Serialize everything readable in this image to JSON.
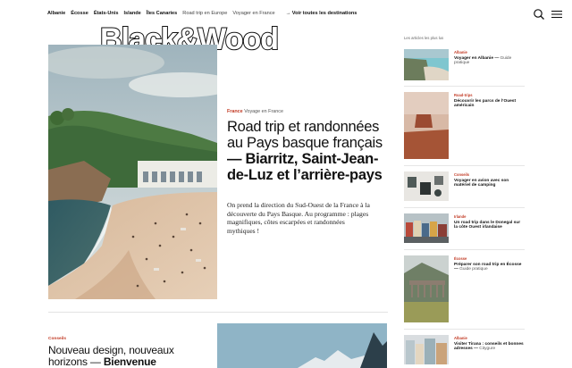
{
  "nav": {
    "items": [
      "Albanie",
      "Écosse",
      "États-Unis",
      "Islande",
      "Îles Canaries",
      "Road trip en Europe",
      "Voyager en France"
    ],
    "all": "→ Voir toutes les destinations"
  },
  "logo": "Black&Wood",
  "hero": {
    "category": "France",
    "subcategory": "Voyage en France",
    "title_regular": "Road trip et randonnées au Pays basque français",
    "title_bold": "— Biarritz, Saint-Jean-de-Luz et l’arrière-pays",
    "description": "On prend la direction du Sud-Ouest de la France à la découverte du Pays Basque. Au programme : plages magnifiques, côtes escarpées et randonnées mythiques !"
  },
  "second": {
    "category": "Conseils",
    "title_regular": "Nouveau design, nouveaux horizons —",
    "title_bold": "Bienvenue"
  },
  "sidebar": {
    "heading": "Les articles les plus lus",
    "items": [
      {
        "category": "Albanie",
        "title": "Voyager en Albanie —",
        "subtitle": "Guide pratique"
      },
      {
        "category": "Road-trips",
        "title": "Découvrir les parcs de l’Ouest américain",
        "subtitle": ""
      },
      {
        "category": "Conseils",
        "title": "Voyager en avion avec son matériel de camping",
        "subtitle": ""
      },
      {
        "category": "Irlande",
        "title": "Un road trip dans le Donegal sur la côte Ouest irlandaise",
        "subtitle": ""
      },
      {
        "category": "Écosse",
        "title": "Préparer son road trip en Écosse —",
        "subtitle": "Guide pratique"
      },
      {
        "category": "Albanie",
        "title": "Visiter Tirana : conseils et bonnes adresses —",
        "subtitle": "Citygure"
      }
    ]
  }
}
